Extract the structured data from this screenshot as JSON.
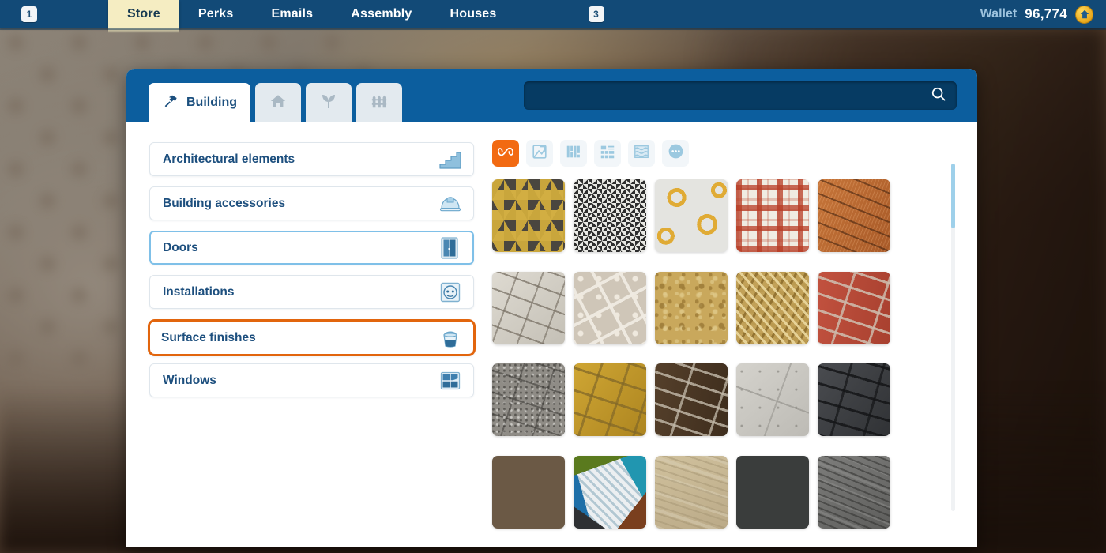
{
  "topbar": {
    "left_badge": "1",
    "mid_badge": "3",
    "tabs": [
      {
        "label": "Store",
        "active": true
      },
      {
        "label": "Perks",
        "active": false
      },
      {
        "label": "Emails",
        "active": false
      },
      {
        "label": "Assembly",
        "active": false
      },
      {
        "label": "Houses",
        "active": false
      }
    ],
    "wallet_label": "Wallet",
    "wallet_amount": "96,774",
    "coin_icon": "house-coin-icon"
  },
  "panel": {
    "tabs": [
      {
        "label": "Building",
        "icon": "hammer-icon",
        "active": true
      },
      {
        "label": "",
        "icon": "home-icon",
        "active": false
      },
      {
        "label": "",
        "icon": "plant-sprout-icon",
        "active": false
      },
      {
        "label": "",
        "icon": "fence-icon",
        "active": false
      }
    ],
    "search": {
      "value": "",
      "placeholder": "",
      "icon": "search-icon"
    }
  },
  "categories": [
    {
      "label": "Architectural elements",
      "icon": "stairs-icon",
      "state": "normal"
    },
    {
      "label": "Building accessories",
      "icon": "hard-hat-icon",
      "state": "normal"
    },
    {
      "label": "Doors",
      "icon": "door-icon",
      "state": "hover"
    },
    {
      "label": "Installations",
      "icon": "power-socket-icon",
      "state": "normal"
    },
    {
      "label": "Surface finishes",
      "icon": "paint-bucket-icon",
      "state": "selected"
    },
    {
      "label": "Windows",
      "icon": "window-icon",
      "state": "normal"
    }
  ],
  "filters": [
    {
      "name": "all-filter",
      "icon": "infinity-icon",
      "active": true
    },
    {
      "name": "wallpaper-filter",
      "icon": "wallpaper-roll-icon",
      "active": false
    },
    {
      "name": "panel-filter",
      "icon": "vertical-panels-icon",
      "active": false
    },
    {
      "name": "tile-filter",
      "icon": "tile-grid-icon",
      "active": false
    },
    {
      "name": "pattern-filter",
      "icon": "wave-pattern-icon",
      "active": false
    },
    {
      "name": "more-filter",
      "icon": "ellipsis-circle-icon",
      "active": false
    }
  ],
  "items": [
    {
      "name": "hexagon-cube-pattern",
      "texture": "tx-hex"
    },
    {
      "name": "houndstooth-pattern",
      "texture": "tx-hound"
    },
    {
      "name": "gold-squiggle-pattern",
      "texture": "tx-squiggle"
    },
    {
      "name": "red-plaid-fabric",
      "texture": "tx-plaid"
    },
    {
      "name": "terracotta-roof-tile",
      "texture": "tx-terracotta"
    },
    {
      "name": "light-cobblestone",
      "texture": "tx-cobble"
    },
    {
      "name": "beige-dotted-tile",
      "texture": "tx-dotgrid"
    },
    {
      "name": "cork-sandstone",
      "texture": "tx-cork"
    },
    {
      "name": "wood-chip-board",
      "texture": "tx-chips"
    },
    {
      "name": "red-brick-wall",
      "texture": "tx-redbrick"
    },
    {
      "name": "grey-granite-paving",
      "texture": "tx-granite"
    },
    {
      "name": "yellow-paver-bricks",
      "texture": "tx-yellowpave"
    },
    {
      "name": "dark-brown-brick",
      "texture": "tx-brownbrick"
    },
    {
      "name": "light-concrete-slabs",
      "texture": "tx-concrete"
    },
    {
      "name": "dark-charcoal-stone",
      "texture": "tx-darkstone"
    },
    {
      "name": "rough-bark-stone",
      "texture": "tx-bark"
    },
    {
      "name": "patchwork-quilt",
      "texture": "tx-patchwork"
    },
    {
      "name": "light-beige-wood",
      "texture": "tx-lightwood"
    },
    {
      "name": "solid-charcoal",
      "texture": "tx-charcoal"
    },
    {
      "name": "grey-wood-grain",
      "texture": "tx-greywood"
    }
  ],
  "colors": {
    "topbar_blue": "#124a77",
    "panel_header_blue": "#0c5e9e",
    "accent_orange": "#e2650d",
    "filter_orange": "#f26a12",
    "active_tab_cream": "#f5edc2",
    "text_blue": "#1d4f7e",
    "scrollbar_blue": "#9ed0ea"
  }
}
